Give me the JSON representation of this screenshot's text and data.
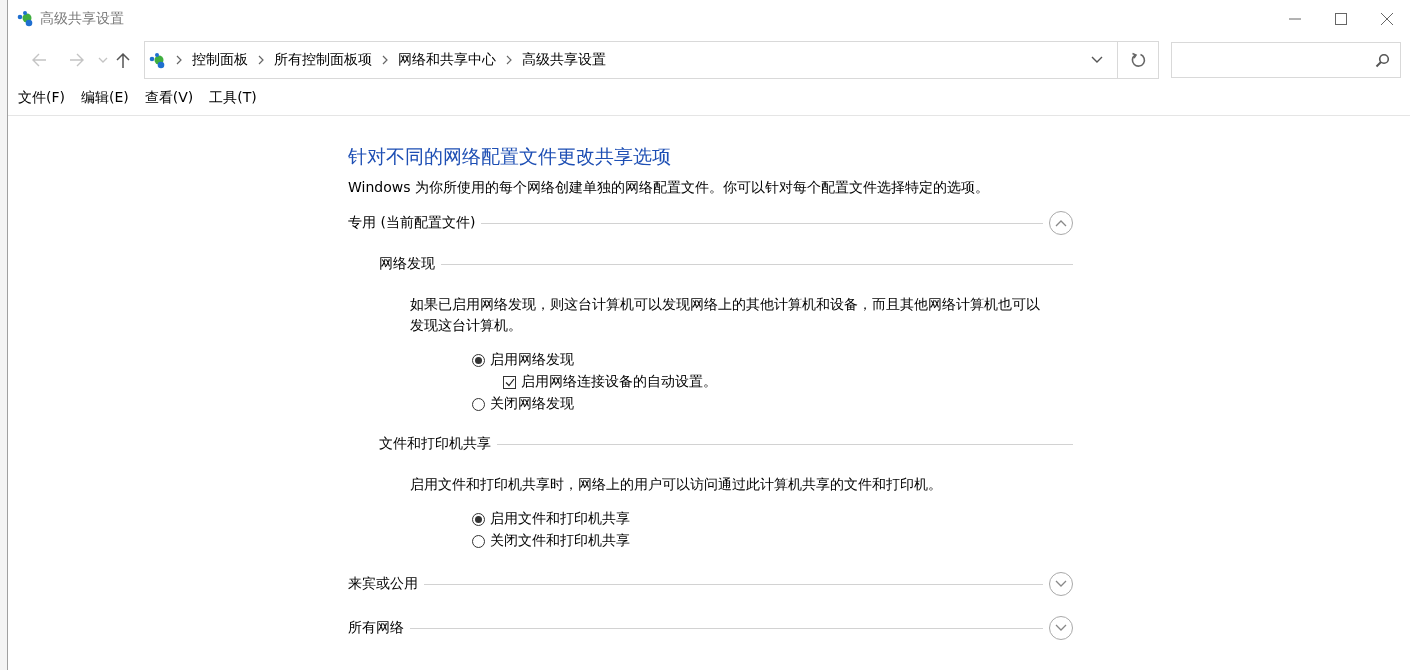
{
  "window": {
    "title": "高级共享设置"
  },
  "address_bar": {
    "breadcrumb": [
      "控制面板",
      "所有控制面板项",
      "网络和共享中心",
      "高级共享设置"
    ]
  },
  "menu": [
    "文件(F)",
    "编辑(E)",
    "查看(V)",
    "工具(T)"
  ],
  "content": {
    "heading": "针对不同的网络配置文件更改共享选项",
    "intro": "Windows 为你所使用的每个网络创建单独的网络配置文件。你可以针对每个配置文件选择特定的选项。",
    "profiles": [
      {
        "title": "专用 (当前配置文件)",
        "expanded": true,
        "sections": [
          {
            "title": "网络发现",
            "description": "如果已启用网络发现，则这台计算机可以发现网络上的其他计算机和设备，而且其他网络计算机也可以发现这台计算机。",
            "options": [
              {
                "kind": "radio",
                "label": "启用网络发现",
                "selected": true
              },
              {
                "kind": "checkbox",
                "label": "启用网络连接设备的自动设置。",
                "checked": true
              },
              {
                "kind": "radio",
                "label": "关闭网络发现",
                "selected": false
              }
            ]
          },
          {
            "title": "文件和打印机共享",
            "description": "启用文件和打印机共享时，网络上的用户可以访问通过此计算机共享的文件和打印机。",
            "options": [
              {
                "kind": "radio",
                "label": "启用文件和打印机共享",
                "selected": true
              },
              {
                "kind": "radio",
                "label": "关闭文件和打印机共享",
                "selected": false
              }
            ]
          }
        ]
      },
      {
        "title": "来宾或公用",
        "expanded": false
      },
      {
        "title": "所有网络",
        "expanded": false
      }
    ]
  }
}
